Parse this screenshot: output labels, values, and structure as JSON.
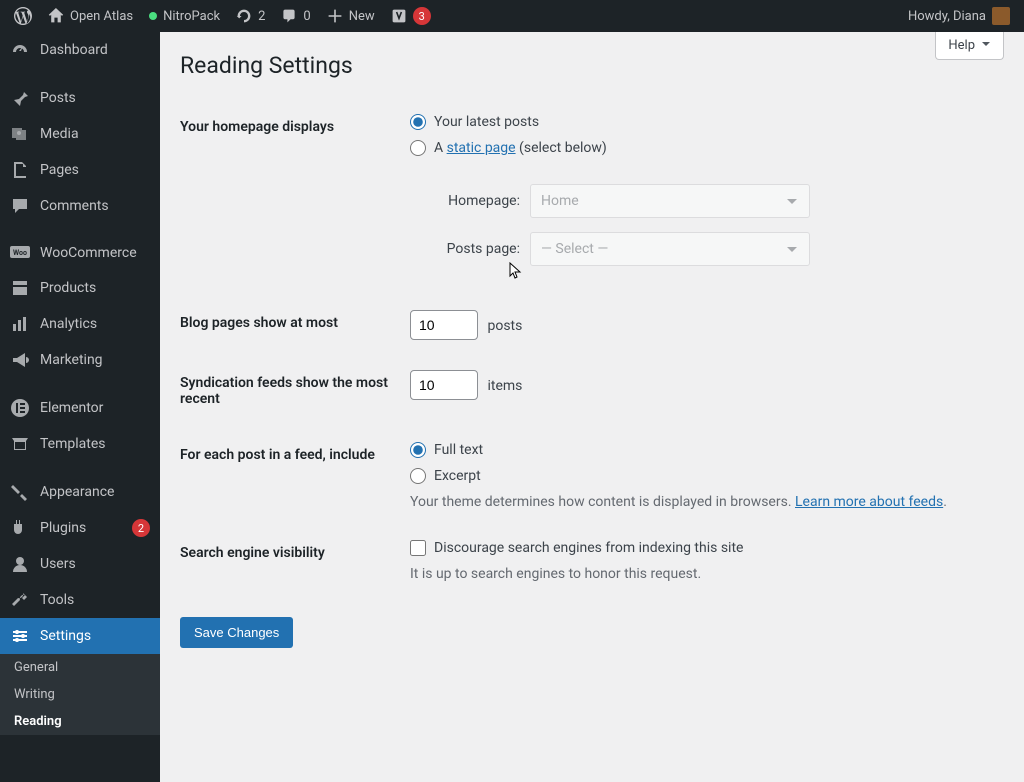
{
  "adminbar": {
    "site_name": "Open Atlas",
    "nitropack": "NitroPack",
    "updates": "2",
    "comments": "0",
    "new": "New",
    "yoast_count": "3",
    "howdy": "Howdy, Diana"
  },
  "menu": {
    "dashboard": "Dashboard",
    "posts": "Posts",
    "media": "Media",
    "pages": "Pages",
    "comments": "Comments",
    "woocommerce": "WooCommerce",
    "products": "Products",
    "analytics": "Analytics",
    "marketing": "Marketing",
    "elementor": "Elementor",
    "templates": "Templates",
    "appearance": "Appearance",
    "plugins": "Plugins",
    "plugins_count": "2",
    "users": "Users",
    "tools": "Tools",
    "settings": "Settings",
    "submenu": {
      "general": "General",
      "writing": "Writing",
      "reading": "Reading"
    }
  },
  "page": {
    "help": "Help",
    "title": "Reading Settings",
    "homepage_label": "Your homepage displays",
    "homepage_opt1": "Your latest posts",
    "homepage_opt2_pre": "A ",
    "homepage_opt2_link": "static page",
    "homepage_opt2_post": " (select below)",
    "homepage_select_label": "Homepage:",
    "homepage_select_value": "Home",
    "postspage_select_label": "Posts page:",
    "postspage_select_value": "— Select —",
    "blog_pages_label": "Blog pages show at most",
    "blog_pages_value": "10",
    "blog_pages_unit": "posts",
    "feeds_label": "Syndication feeds show the most recent",
    "feeds_value": "10",
    "feeds_unit": "items",
    "feed_include_label": "For each post in a feed, include",
    "feed_opt1": "Full text",
    "feed_opt2": "Excerpt",
    "feed_desc_pre": "Your theme determines how content is displayed in browsers. ",
    "feed_desc_link": "Learn more about feeds",
    "feed_desc_post": ".",
    "search_label": "Search engine visibility",
    "search_check": "Discourage search engines from indexing this site",
    "search_desc": "It is up to search engines to honor this request.",
    "save": "Save Changes"
  }
}
